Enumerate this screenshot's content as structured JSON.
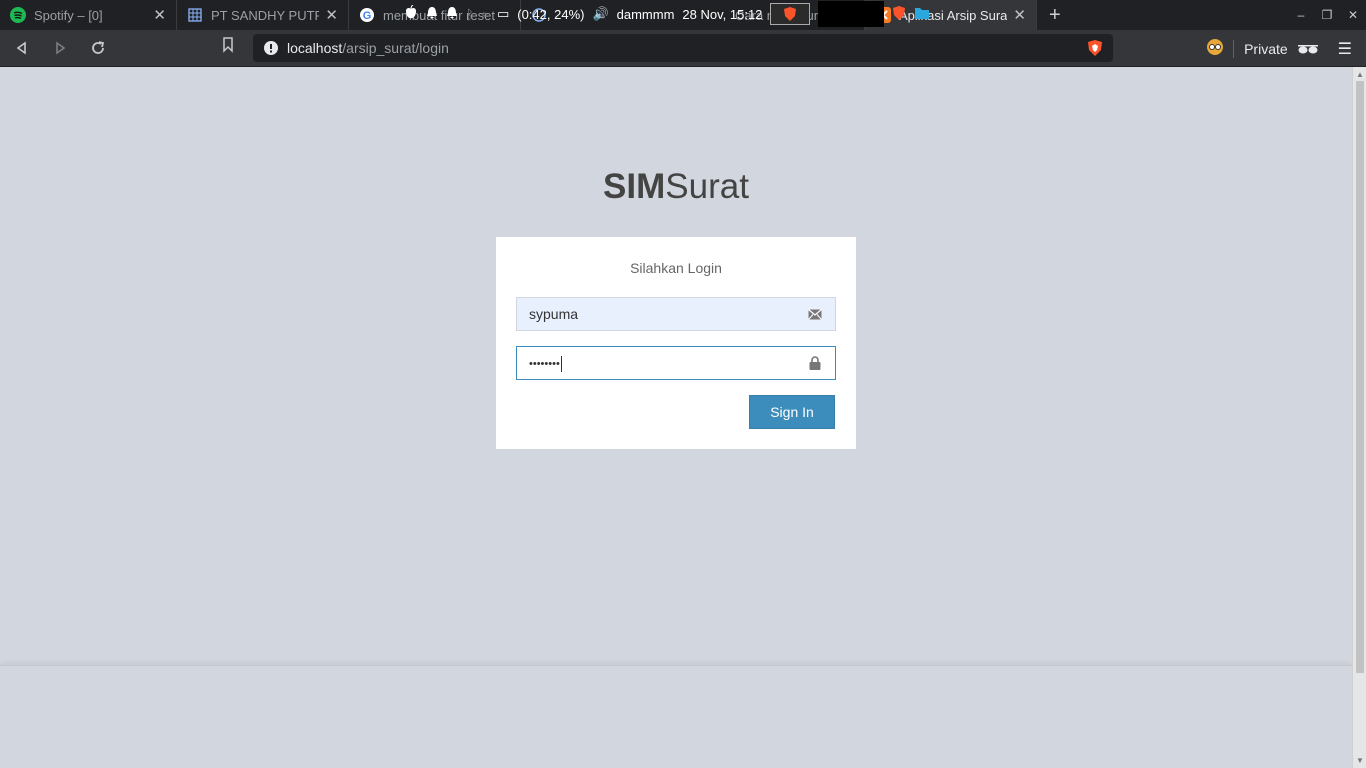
{
  "tabs": [
    {
      "title": "Spotify – [0]",
      "icon": "spotify-icon"
    },
    {
      "title": "PT SANDHY PUTRA",
      "icon": "sheets-icon"
    },
    {
      "title": "membuat fitur reset",
      "icon": "google-icon"
    },
    {
      "title": "Cara menggunakan",
      "icon": "page-icon"
    },
    {
      "title": "Aplikasi Arsip Surat",
      "icon": "xampp-icon"
    }
  ],
  "systray": {
    "battery": "(0:42, 24%)",
    "user": "dammmm",
    "datetime": "28 Nov, 15:12"
  },
  "toolbar": {
    "url_host": "localhost",
    "url_path": "/arsip_surat/login",
    "private_label": "Private"
  },
  "login": {
    "logo_bold": "SIM",
    "logo_rest": "Surat",
    "message": "Silahkan Login",
    "username_value": "sypuma",
    "password_mask": "••••••••",
    "signin_label": "Sign In"
  },
  "colors": {
    "primary": "#3c8dbc",
    "background": "#d2d6de"
  }
}
